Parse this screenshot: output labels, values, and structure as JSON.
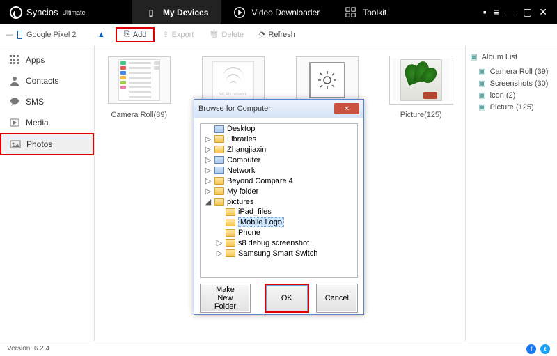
{
  "app": {
    "title": "Syncios",
    "edition": "Ultimate"
  },
  "top_tabs": {
    "devices": "My Devices",
    "downloader": "Video Downloader",
    "toolkit": "Toolkit"
  },
  "window_controls": {
    "chat": "▪",
    "menu": "≡",
    "min": "—",
    "max": "▢",
    "close": "✕"
  },
  "device": {
    "name": "Google Pixel 2"
  },
  "toolbar": {
    "add": "Add",
    "export": "Export",
    "delete": "Delete",
    "refresh": "Refresh"
  },
  "sidebar": {
    "items": [
      {
        "label": "Apps"
      },
      {
        "label": "Contacts"
      },
      {
        "label": "SMS"
      },
      {
        "label": "Media"
      },
      {
        "label": "Photos"
      }
    ]
  },
  "content": {
    "thumbs": [
      {
        "label": "Camera Roll(39)"
      },
      {
        "label": ""
      },
      {
        "label": ""
      },
      {
        "label": "Picture(125)"
      }
    ]
  },
  "album_panel": {
    "header": "Album List",
    "items": [
      {
        "label": "Camera Roll (39)"
      },
      {
        "label": "Screenshots (30)"
      },
      {
        "label": "icon (2)"
      },
      {
        "label": "Picture (125)"
      }
    ]
  },
  "dialog": {
    "title": "Browse for Computer",
    "tree": [
      {
        "indent": 0,
        "twisty": "",
        "icon": "comp",
        "label": "Desktop"
      },
      {
        "indent": 0,
        "twisty": "▷",
        "icon": "folder",
        "label": "Libraries"
      },
      {
        "indent": 0,
        "twisty": "▷",
        "icon": "folder",
        "label": "Zhangjiaxin"
      },
      {
        "indent": 0,
        "twisty": "▷",
        "icon": "comp",
        "label": "Computer"
      },
      {
        "indent": 0,
        "twisty": "▷",
        "icon": "comp",
        "label": "Network"
      },
      {
        "indent": 0,
        "twisty": "▷",
        "icon": "folder",
        "label": "Beyond Compare 4"
      },
      {
        "indent": 0,
        "twisty": "▷",
        "icon": "folder",
        "label": "My folder"
      },
      {
        "indent": 0,
        "twisty": "◢",
        "icon": "folder",
        "label": "pictures"
      },
      {
        "indent": 1,
        "twisty": "",
        "icon": "folder",
        "label": "iPad_files"
      },
      {
        "indent": 1,
        "twisty": "",
        "icon": "folder",
        "label": "Mobile Logo",
        "selected": true
      },
      {
        "indent": 1,
        "twisty": "",
        "icon": "folder",
        "label": "Phone"
      },
      {
        "indent": 1,
        "twisty": "▷",
        "icon": "folder",
        "label": "s8 debug screenshot"
      },
      {
        "indent": 1,
        "twisty": "▷",
        "icon": "folder",
        "label": "Samsung Smart Switch"
      }
    ],
    "make_folder": "Make New Folder",
    "ok": "OK",
    "cancel": "Cancel"
  },
  "footer": {
    "version": "Version: 6.2.4"
  },
  "colors": {
    "highlight_red": "#e00000",
    "fb": "#1877f2",
    "tw": "#1da1f2"
  }
}
